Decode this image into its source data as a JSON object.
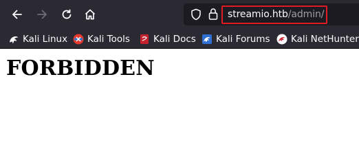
{
  "toolbar": {
    "back_icon": "arrow-left-icon",
    "forward_icon": "arrow-right-icon",
    "reload_icon": "reload-icon",
    "home_icon": "home-icon"
  },
  "urlbar": {
    "host": "streamio.htb",
    "path": "/admin/",
    "highlight_color": "#e01b24"
  },
  "bookmarks": [
    {
      "label": "Kali Linux",
      "icon": "kali-dragon-icon"
    },
    {
      "label": "Kali Tools",
      "icon": "kali-tools-icon"
    },
    {
      "label": "Kali Docs",
      "icon": "kali-docs-icon"
    },
    {
      "label": "Kali Forums",
      "icon": "kali-forums-icon"
    },
    {
      "label": "Kali NetHunter",
      "icon": "kali-nethunter-icon"
    }
  ],
  "page": {
    "heading": "FORBIDDEN"
  },
  "colors": {
    "chrome_bg": "#2b2a33",
    "urlbar_bg": "#1c1b22",
    "page_bg": "#ffffff"
  }
}
